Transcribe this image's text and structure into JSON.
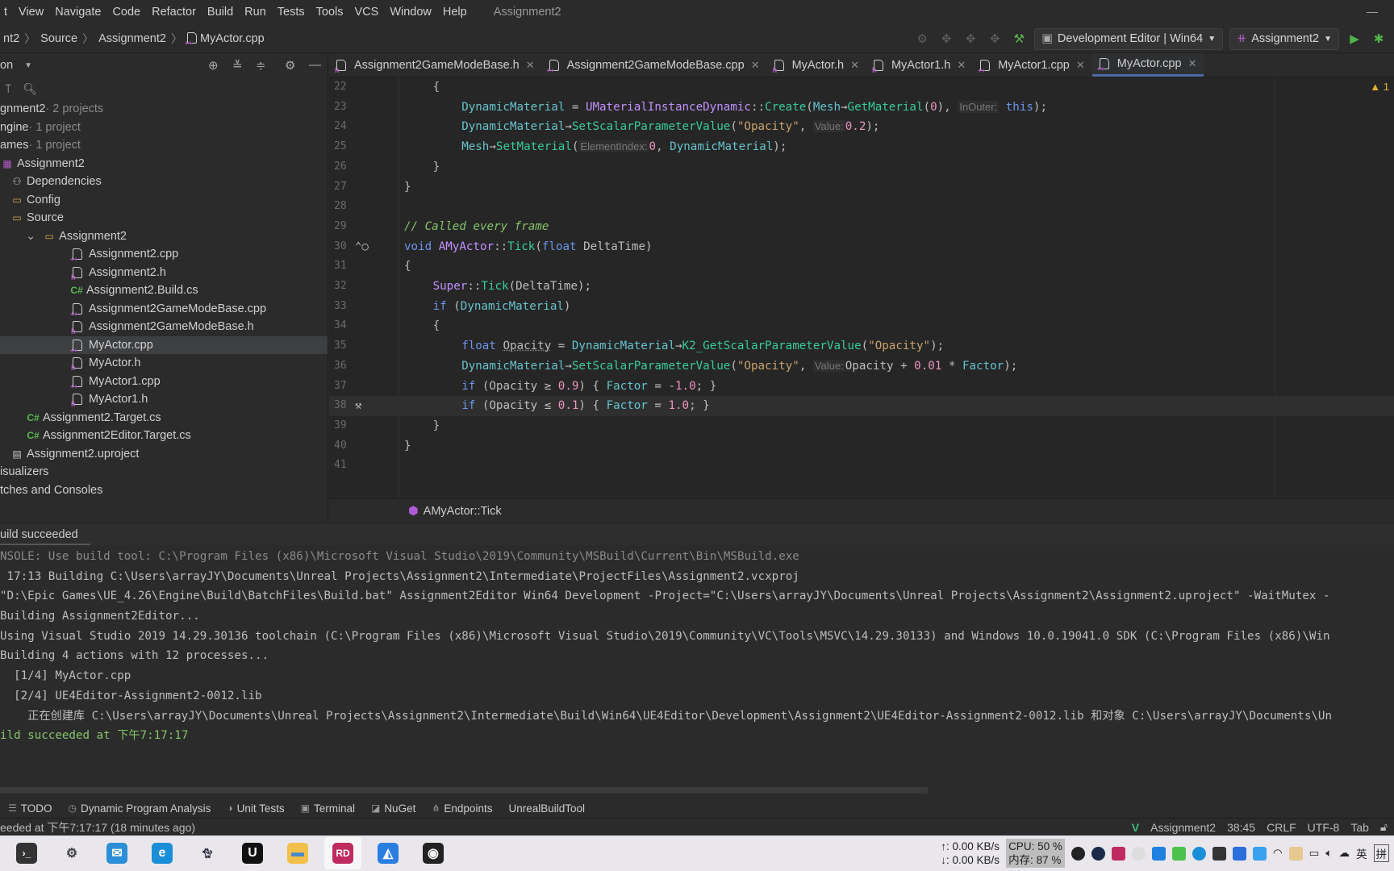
{
  "menu": {
    "items": [
      "t",
      "View",
      "Navigate",
      "Code",
      "Refactor",
      "Build",
      "Run",
      "Tests",
      "Tools",
      "VCS",
      "Window",
      "Help"
    ],
    "window_title": "Assignment2"
  },
  "breadcrumb": [
    "nt2",
    "Source",
    "Assignment2",
    "MyActor.cpp"
  ],
  "toolbar": {
    "config": "Development Editor | Win64",
    "project": "Assignment2"
  },
  "sidebar": {
    "header": "on",
    "items": [
      {
        "label": "gnment2",
        "suffix": " · 2 projects",
        "depth": 0,
        "icon": "solution-icon"
      },
      {
        "label": "ngine",
        "suffix": " · 1 project",
        "depth": 0,
        "icon": "folder-icon"
      },
      {
        "label": "ames",
        "suffix": " · 1 project",
        "depth": 0,
        "icon": "folder-icon"
      },
      {
        "label": "Assignment2",
        "depth": 0,
        "icon": "cpp-project-icon"
      },
      {
        "label": "Dependencies",
        "depth": 1,
        "icon": "dependencies-icon"
      },
      {
        "label": "Config",
        "depth": 1,
        "icon": "folder-icon"
      },
      {
        "label": "Source",
        "depth": 1,
        "icon": "folder-icon"
      },
      {
        "label": "Assignment2",
        "depth": 2,
        "icon": "folder-icon",
        "expanded": true
      },
      {
        "label": "Assignment2.cpp",
        "depth": 3,
        "icon": "cpp-file-icon"
      },
      {
        "label": "Assignment2.h",
        "depth": 3,
        "icon": "header-file-icon"
      },
      {
        "label": "Assignment2.Build.cs",
        "depth": 3,
        "icon": "csharp-file-icon"
      },
      {
        "label": "Assignment2GameModeBase.cpp",
        "depth": 3,
        "icon": "cpp-file-icon"
      },
      {
        "label": "Assignment2GameModeBase.h",
        "depth": 3,
        "icon": "header-file-icon"
      },
      {
        "label": "MyActor.cpp",
        "depth": 3,
        "icon": "cpp-file-icon",
        "selected": true
      },
      {
        "label": "MyActor.h",
        "depth": 3,
        "icon": "header-file-icon"
      },
      {
        "label": "MyActor1.cpp",
        "depth": 3,
        "icon": "cpp-file-icon"
      },
      {
        "label": "MyActor1.h",
        "depth": 3,
        "icon": "header-file-icon"
      },
      {
        "label": "Assignment2.Target.cs",
        "depth": 2,
        "icon": "csharp-file-icon"
      },
      {
        "label": "Assignment2Editor.Target.cs",
        "depth": 2,
        "icon": "csharp-file-icon"
      },
      {
        "label": "Assignment2.uproject",
        "depth": 1,
        "icon": "uproject-icon"
      },
      {
        "label": "isualizers",
        "depth": 0,
        "icon": ""
      },
      {
        "label": "tches and Consoles",
        "depth": 0,
        "icon": ""
      }
    ]
  },
  "tabs": [
    {
      "label": "Assignment2GameModeBase.h",
      "type": "h"
    },
    {
      "label": "Assignment2GameModeBase.cpp",
      "type": "cpp"
    },
    {
      "label": "MyActor.h",
      "type": "h"
    },
    {
      "label": "MyActor1.h",
      "type": "h"
    },
    {
      "label": "MyActor1.cpp",
      "type": "cpp"
    },
    {
      "label": "MyActor.cpp",
      "type": "cpp",
      "active": true
    }
  ],
  "editor": {
    "warnings": "1",
    "current_line": 38,
    "lines": [
      {
        "n": "22",
        "indent": 1,
        "tokens": [
          [
            "{",
            "plain"
          ]
        ]
      },
      {
        "n": "23",
        "indent": 2,
        "tokens": [
          [
            "DynamicMaterial",
            "var"
          ],
          [
            " = ",
            "plain"
          ],
          [
            "UMaterialInstanceDynamic",
            "type"
          ],
          [
            "::",
            "plain"
          ],
          [
            "Create",
            "func"
          ],
          [
            "(",
            "plain"
          ],
          [
            "Mesh",
            "var"
          ],
          [
            "→",
            "plain"
          ],
          [
            "GetMaterial",
            "func"
          ],
          [
            "(",
            "plain"
          ],
          [
            "0",
            "num"
          ],
          "), ",
          [
            "InOuter:",
            "hint"
          ],
          [
            " this",
            "kw"
          ],
          [
            ");",
            "plain"
          ]
        ]
      },
      {
        "n": "24",
        "indent": 2,
        "tokens": [
          [
            "DynamicMaterial",
            "var"
          ],
          [
            "→",
            "plain"
          ],
          [
            "SetScalarParameterValue",
            "func"
          ],
          [
            "(",
            "plain"
          ],
          [
            "\"Opacity\"",
            "str"
          ],
          [
            ", ",
            "plain"
          ],
          [
            "Value:",
            "hint"
          ],
          [
            "0.2",
            "num"
          ],
          [
            ");",
            "plain"
          ]
        ]
      },
      {
        "n": "25",
        "indent": 2,
        "tokens": [
          [
            "Mesh",
            "var"
          ],
          [
            "→",
            "plain"
          ],
          [
            "SetMaterial",
            "func"
          ],
          [
            "(",
            "plain"
          ],
          [
            "ElementIndex:",
            "hint"
          ],
          [
            "0",
            "num"
          ],
          [
            ", ",
            "plain"
          ],
          [
            "DynamicMaterial",
            "var"
          ],
          [
            ");",
            "plain"
          ]
        ]
      },
      {
        "n": "26",
        "indent": 1,
        "tokens": [
          [
            "}",
            "plain"
          ]
        ]
      },
      {
        "n": "27",
        "indent": 0,
        "tokens": [
          [
            "}",
            "plain"
          ]
        ]
      },
      {
        "n": "28",
        "indent": 0,
        "tokens": []
      },
      {
        "n": "29",
        "indent": 0,
        "tokens": [
          [
            "// Called every frame",
            "comment"
          ]
        ]
      },
      {
        "n": "30",
        "indent": 0,
        "gutter": "override-icon",
        "tokens": [
          [
            "void",
            "kw"
          ],
          [
            " ",
            "plain"
          ],
          [
            "AMyActor",
            "type"
          ],
          [
            "::",
            "plain"
          ],
          [
            "Tick",
            "func"
          ],
          [
            "(",
            "plain"
          ],
          [
            "float",
            "kw"
          ],
          [
            " ",
            "plain"
          ],
          [
            "DeltaTime",
            "param"
          ],
          [
            ")",
            "plain"
          ]
        ]
      },
      {
        "n": "31",
        "indent": 0,
        "tokens": [
          [
            "{",
            "plain"
          ]
        ]
      },
      {
        "n": "32",
        "indent": 1,
        "tokens": [
          [
            "Super",
            "type"
          ],
          [
            "::",
            "plain"
          ],
          [
            "Tick",
            "func"
          ],
          [
            "(DeltaTime);",
            "plain"
          ]
        ]
      },
      {
        "n": "33",
        "indent": 1,
        "tokens": [
          [
            "if",
            "kw"
          ],
          [
            " (",
            "plain"
          ],
          [
            "DynamicMaterial",
            "var"
          ],
          [
            ")",
            "plain"
          ]
        ]
      },
      {
        "n": "34",
        "indent": 1,
        "tokens": [
          [
            "{",
            "plain"
          ]
        ]
      },
      {
        "n": "35",
        "indent": 2,
        "tokens": [
          [
            "float",
            "kw"
          ],
          [
            " ",
            "plain"
          ],
          [
            "Opacity",
            "param"
          ],
          [
            " = ",
            "plain"
          ],
          [
            "DynamicMaterial",
            "var"
          ],
          [
            "→",
            "plain"
          ],
          [
            "K2_GetScalarParameterValue",
            "func"
          ],
          [
            "(",
            "plain"
          ],
          [
            "\"Opacity\"",
            "str"
          ],
          [
            ");",
            "plain"
          ]
        ]
      },
      {
        "n": "36",
        "indent": 2,
        "tokens": [
          [
            "DynamicMaterial",
            "var"
          ],
          [
            "→",
            "plain"
          ],
          [
            "SetScalarParameterValue",
            "func"
          ],
          [
            "(",
            "plain"
          ],
          [
            "\"Opacity\"",
            "str"
          ],
          [
            ", ",
            "plain"
          ],
          [
            "Value:",
            "hint"
          ],
          [
            "Opacity + ",
            "plain"
          ],
          [
            "0.01",
            "num"
          ],
          [
            " * ",
            "plain"
          ],
          [
            "Factor",
            "var"
          ],
          [
            ");",
            "plain"
          ]
        ]
      },
      {
        "n": "37",
        "indent": 2,
        "tokens": [
          [
            "if",
            "kw"
          ],
          [
            " (Opacity ≥ ",
            "plain"
          ],
          [
            "0.9",
            "num"
          ],
          [
            ") { ",
            "plain"
          ],
          [
            "Factor",
            "var"
          ],
          [
            " = -",
            "plain"
          ],
          [
            "1.0",
            "num"
          ],
          [
            "; }",
            "plain"
          ]
        ]
      },
      {
        "n": "38",
        "indent": 2,
        "gutter": "build-hammer-icon",
        "tokens": [
          [
            "if",
            "kw"
          ],
          [
            " (Opacity ≤ ",
            "plain"
          ],
          [
            "0.1",
            "num"
          ],
          [
            ") { ",
            "plain"
          ],
          [
            "Factor",
            "var"
          ],
          [
            " = ",
            "plain"
          ],
          [
            "1.0",
            "num"
          ],
          [
            "; }",
            "plain"
          ]
        ]
      },
      {
        "n": "39",
        "indent": 1,
        "tokens": [
          [
            "}",
            "plain"
          ]
        ]
      },
      {
        "n": "40",
        "indent": 0,
        "tokens": [
          [
            "}",
            "plain"
          ]
        ]
      },
      {
        "n": "41",
        "indent": 0,
        "tokens": []
      }
    ],
    "breadcrumb": "AMyActor::Tick"
  },
  "build": {
    "title": "uild succeeded",
    "lines": [
      {
        "text": "NSOLE: Use build tool: C:\\Program Files (x86)\\Microsoft Visual Studio\\2019\\Community\\MSBuild\\Current\\Bin\\MSBuild.exe",
        "kind": "dim"
      },
      {
        "text": " 17:13 Building C:\\Users\\arrayJY\\Documents\\Unreal Projects\\Assignment2\\Intermediate\\ProjectFiles\\Assignment2.vcxproj",
        "kind": ""
      },
      {
        "text": "\"D:\\Epic Games\\UE_4.26\\Engine\\Build\\BatchFiles\\Build.bat\" Assignment2Editor Win64 Development -Project=\"C:\\Users\\arrayJY\\Documents\\Unreal Projects\\Assignment2\\Assignment2.uproject\" -WaitMutex -",
        "kind": ""
      },
      {
        "text": "Building Assignment2Editor...",
        "kind": ""
      },
      {
        "text": "Using Visual Studio 2019 14.29.30136 toolchain (C:\\Program Files (x86)\\Microsoft Visual Studio\\2019\\Community\\VC\\Tools\\MSVC\\14.29.30133) and Windows 10.0.19041.0 SDK (C:\\Program Files (x86)\\Win",
        "kind": ""
      },
      {
        "text": "Building 4 actions with 12 processes...",
        "kind": ""
      },
      {
        "text": "  [1/4] MyActor.cpp",
        "kind": ""
      },
      {
        "text": "  [2/4] UE4Editor-Assignment2-0012.lib",
        "kind": ""
      },
      {
        "text": "    正在创建库 C:\\Users\\arrayJY\\Documents\\Unreal Projects\\Assignment2\\Intermediate\\Build\\Win64\\UE4Editor\\Development\\Assignment2\\UE4Editor-Assignment2-0012.lib 和对象 C:\\Users\\arrayJY\\Documents\\Un",
        "kind": ""
      },
      {
        "text": "ild succeeded at 下午7:17:17",
        "kind": "ok"
      }
    ]
  },
  "toolwindows": [
    {
      "label": "TODO",
      "icon": "todo-icon"
    },
    {
      "label": "Dynamic Program Analysis",
      "icon": "dpa-icon"
    },
    {
      "label": "Unit Tests",
      "icon": "unit-tests-icon"
    },
    {
      "label": "Terminal",
      "icon": "terminal-icon"
    },
    {
      "label": "NuGet",
      "icon": "nuget-icon"
    },
    {
      "label": "Endpoints",
      "icon": "endpoints-icon"
    },
    {
      "label": "UnrealBuildTool",
      "icon": ""
    }
  ],
  "status": {
    "message": "eeded at 下午7:17:17 (18 minutes ago)",
    "project": "Assignment2",
    "position": "38:45",
    "line_ending": "CRLF",
    "encoding": "UTF-8",
    "indent": "Tab"
  },
  "taskbar": {
    "apps": [
      "terminal-icon",
      "settings-icon",
      "mail-icon",
      "edge-icon",
      "cat-app-icon",
      "unreal-icon",
      "file-explorer-icon",
      "rider-icon",
      "app-icon",
      "obs-icon"
    ],
    "active_app": "rider-icon",
    "net_up": "↑: 0.00 KB/s",
    "net_down": "↓: 0.00 KB/s",
    "cpu": "CPU: 50 %",
    "mem": "内存: 87 %",
    "ime_lang": "英",
    "ime_mode": "拼"
  },
  "colors": {
    "accent": "#4a6da7",
    "keyword": "#6c95eb",
    "function": "#39cc9b",
    "type": "#c191ff",
    "string": "#c9a26d",
    "number": "#ed94c0",
    "comment": "#85c46c",
    "variable": "#66c3cc"
  }
}
